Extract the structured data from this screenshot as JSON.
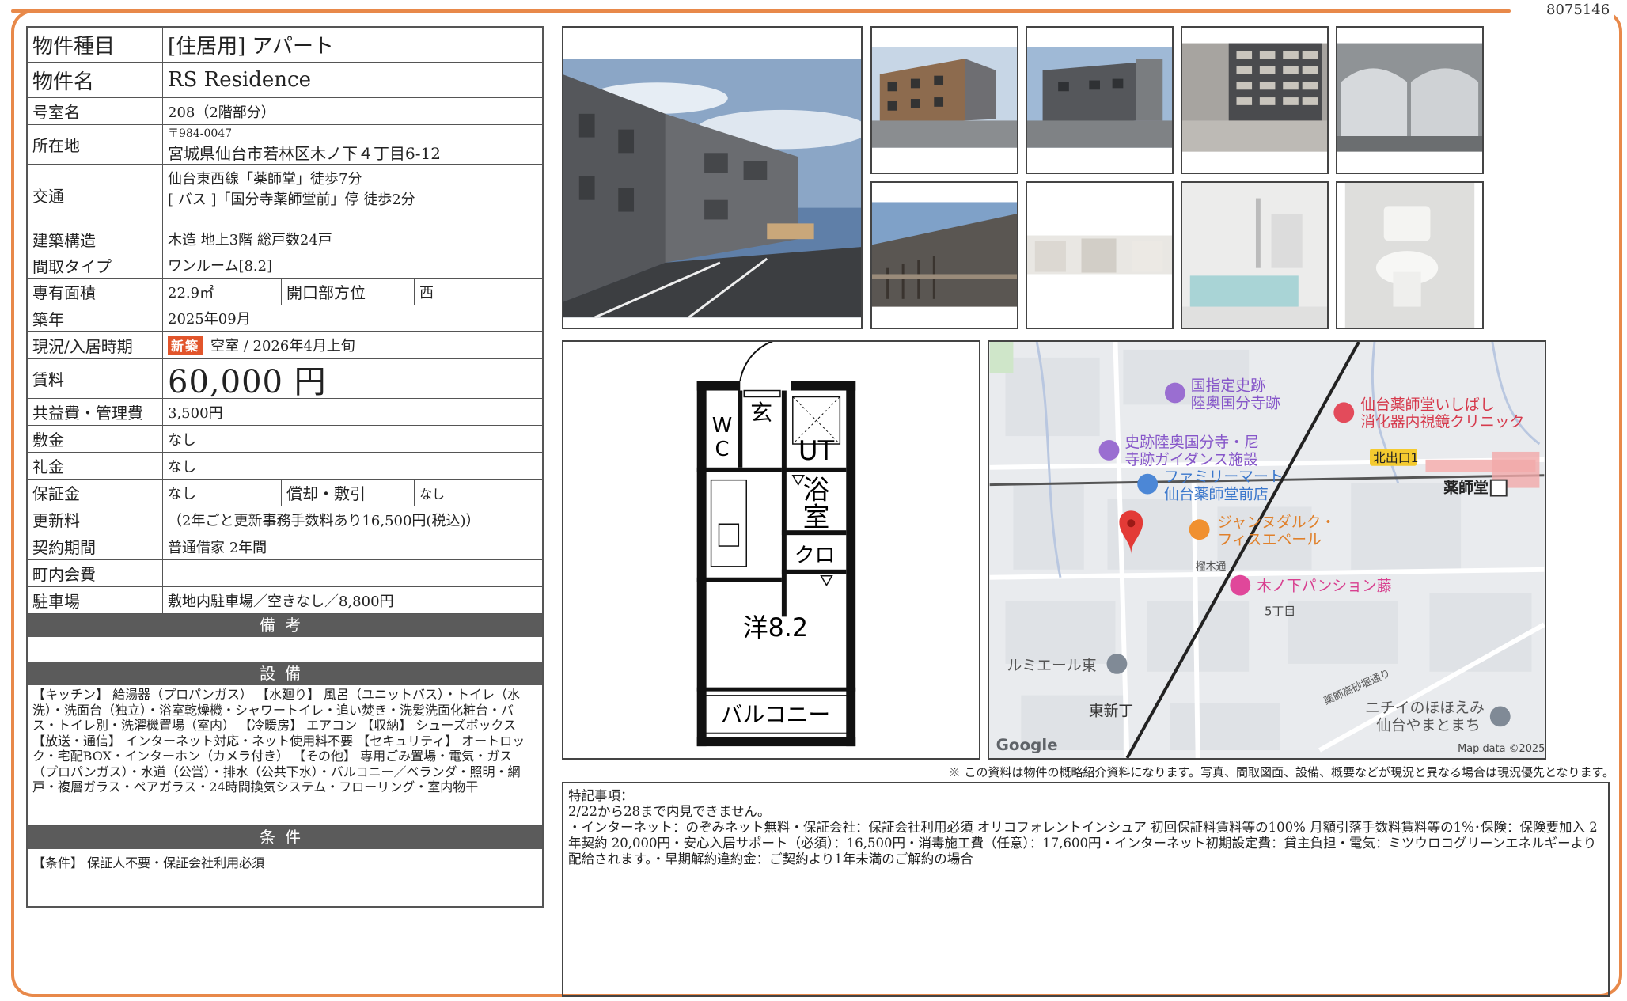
{
  "property_id": "8075146",
  "table": {
    "type_label": "物件種目",
    "type_value": "[住居用]  アパート",
    "name_label": "物件名",
    "name_value": "RS Residence",
    "room_label": "号室名",
    "room_value": "208（2階部分）",
    "address_label": "所在地",
    "address_zip": "〒984-0047",
    "address_value": "宮城県仙台市若林区木ノ下４丁目6-12",
    "transport_label": "交通",
    "transport_line1": "仙台東西線「薬師堂」徒歩7分",
    "transport_line2": "[ バス ]「国分寺薬師堂前」停  徒歩2分",
    "structure_label": "建築構造",
    "structure_value": "木造 地上3階 総戸数24戸",
    "layout_label": "間取タイプ",
    "layout_value": "ワンルーム[8.2]",
    "area_label": "専有面積",
    "area_value": "22.9㎡",
    "direction_label": "開口部方位",
    "direction_value": "西",
    "built_label": "築年",
    "built_value": "2025年09月",
    "status_label": "現況/入居時期",
    "status_badge": "新築",
    "status_value": "空室 /  2026年4月上旬",
    "rent_label": "賃料",
    "rent_value": "60,000 円",
    "fee_label": "共益費・管理費",
    "fee_value": "3,500円",
    "deposit_label": "敷金",
    "deposit_value": "なし",
    "key_money_label": "礼金",
    "key_money_value": "なし",
    "guarantee_label": "保証金",
    "guarantee_value": "なし",
    "amortization_label": "償却・敷引",
    "amortization_value": "なし",
    "renewal_label": "更新料",
    "renewal_value": "（2年ごと更新事務手数料あり16,500円(税込)）",
    "contract_label": "契約期間",
    "contract_value": "普通借家 2年間",
    "association_label": "町内会費",
    "association_value": "",
    "parking_label": "駐車場",
    "parking_value": "敷地内駐車場／空きなし／8,800円"
  },
  "sections": {
    "notes_title": "備考",
    "equipment_title": "設備",
    "equipment_text": "【キッチン】 給湯器（プロパンガス） 【水廻り】 風呂（ユニットバス）・トイレ（水洗）・洗面台（独立）・浴室乾燥機・シャワートイレ・追い焚き・洗髪洗面化粧台・バス・トイレ別・洗濯機置場（室内） 【冷暖房】 エアコン 【収納】 シューズボックス 【放送・通信】 インターネット対応・ネット使用料不要 【セキュリティ】 オートロック・宅配BOX・インターホン（カメラ付き） 【その他】 専用ごみ置場・電気・ガス（プロパンガス）・水道（公営）・排水（公共下水）・バルコニー／ベランダ・照明・網戸・複層ガラス・ペアガラス・24時間換気システム・フローリング・室内物干",
    "conditions_title": "条件",
    "conditions_text": "【条件】 保証人不要・保証会社利用必須"
  },
  "floorplan": {
    "entrance": "玄",
    "wc1": "W",
    "wc2": "C",
    "ut": "UT",
    "bath1": "浴",
    "bath2": "室",
    "closet": "クロ",
    "room": "洋8.2",
    "balcony": "バルコニー"
  },
  "map": {
    "poi1a": "国指定史跡",
    "poi1b": "陸奥国分寺跡",
    "poi2a": "仙台薬師堂いしばし",
    "poi2b": "消化器内視鏡クリニック",
    "poi3a": "史跡陸奥国分寺・尼",
    "poi3b": "寺跡ガイダンス施設",
    "exit": "北出口1",
    "poi4a": "ファミリーマート",
    "poi4b": "仙台薬師堂前店",
    "station": "薬師堂",
    "poi5a": "ジャンヌダルク・",
    "poi5b": "フィスエペール",
    "road1": "榴木通",
    "poi6": "木ノ下パンション藤",
    "block": "5丁目",
    "poi7": "ルミエール東",
    "area": "東新丁",
    "road2": "薬師高砂堀通り",
    "poi8a": "ニチイのほほえみ",
    "poi8b": "仙台やまとまち",
    "google": "Google",
    "mapdata": "Map data ©2025"
  },
  "disclaimer": "※ この資料は物件の概略紹介資料になります。写真、間取図面、設備、概要などが現況と異なる場合は現況優先となります。",
  "special": {
    "heading": "特記事項：",
    "line1": "2/22から28まで内見できません。",
    "line2": "・インターネット：のぞみネット無料・保証会社：保証会社利用必須 オリコフォレントインシュア 初回保証料賃料等の100% 月額引落手数料賃料等の1%･保険：保険要加入 2年契約 20,000円・安心入居サポート（必須）：16,500円・消毒施工費（任意）：17,600円・インターネット初期設定費：貸主負担・電気：ミツウロコグリーンエネルギーより配給されます。・早期解約違約金：ご契約より1年未満のご解約の場合"
  },
  "colors": {
    "frame": "#e8894a",
    "badge": "#e2552b",
    "section_bar": "#5b5b5b"
  }
}
